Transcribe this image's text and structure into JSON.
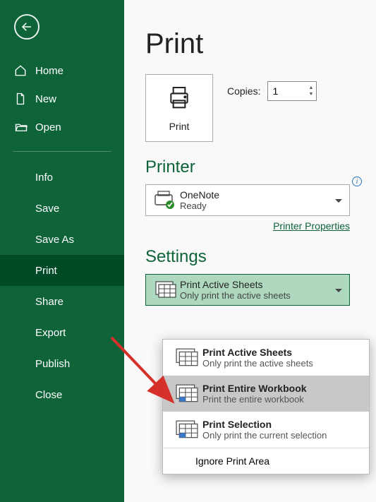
{
  "sidebar": {
    "top": [
      {
        "label": "Home"
      },
      {
        "label": "New"
      },
      {
        "label": "Open"
      }
    ],
    "bottom": [
      {
        "label": "Info"
      },
      {
        "label": "Save"
      },
      {
        "label": "Save As"
      },
      {
        "label": "Print"
      },
      {
        "label": "Share"
      },
      {
        "label": "Export"
      },
      {
        "label": "Publish"
      },
      {
        "label": "Close"
      }
    ],
    "activeIndex": 3
  },
  "page": {
    "title": "Print",
    "printButtonLabel": "Print",
    "copiesLabel": "Copies:",
    "copiesValue": "1"
  },
  "printerSection": {
    "heading": "Printer",
    "name": "OneNote",
    "status": "Ready",
    "propertiesLink": "Printer Properties"
  },
  "settingsSection": {
    "heading": "Settings",
    "selected": {
      "title": "Print Active Sheets",
      "subtitle": "Only print the active sheets"
    },
    "options": [
      {
        "title": "Print Active Sheets",
        "subtitle": "Only print the active sheets",
        "iconAccent": "none"
      },
      {
        "title": "Print Entire Workbook",
        "subtitle": "Print the entire workbook",
        "iconAccent": "blue"
      },
      {
        "title": "Print Selection",
        "subtitle": "Only print the current selection",
        "iconAccent": "blue"
      }
    ],
    "footer": "Ignore Print Area",
    "hoveredIndex": 1
  }
}
